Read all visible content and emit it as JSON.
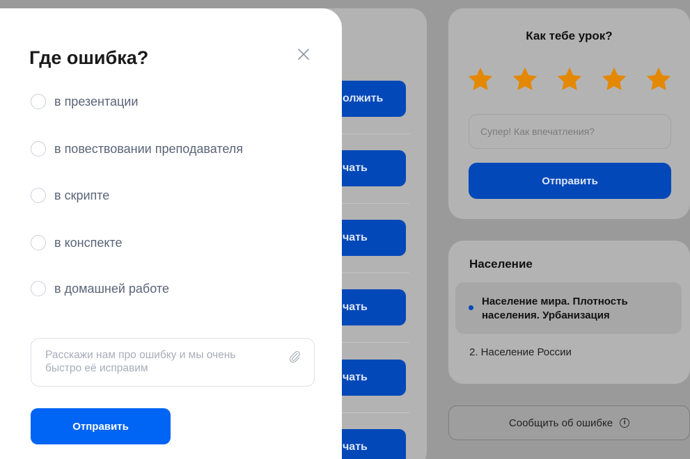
{
  "background": {
    "lesson_buttons": [
      "олжить",
      "чать",
      "чать",
      "чать",
      "чать",
      "чать"
    ]
  },
  "rating": {
    "title": "Как тебе урок?",
    "stars": 5,
    "star_color": "#e48800",
    "input_placeholder": "Супер! Как впечатления?",
    "send_label": "Отправить"
  },
  "toc": {
    "title": "Население",
    "items": [
      {
        "label": "Население мира. Плотность населения. Урбанизация"
      },
      {
        "label": "2. Население России"
      }
    ]
  },
  "report_button": {
    "label": "Сообщить об ошибке",
    "icon": "info-icon"
  },
  "modal": {
    "title": "Где ошибка?",
    "close_icon": "close-icon",
    "options": [
      {
        "label": "в презентации"
      },
      {
        "label": "в повествовании преподавателя"
      },
      {
        "label": "в скрипте"
      },
      {
        "label": "в конспекте"
      },
      {
        "label": "в домашней работе"
      }
    ],
    "feedback_placeholder": "Расскажи нам про ошибку и мы очень быстро её исправим",
    "attach_icon": "paperclip-icon",
    "send_label": "Отправить",
    "accent": "#0064f4"
  }
}
